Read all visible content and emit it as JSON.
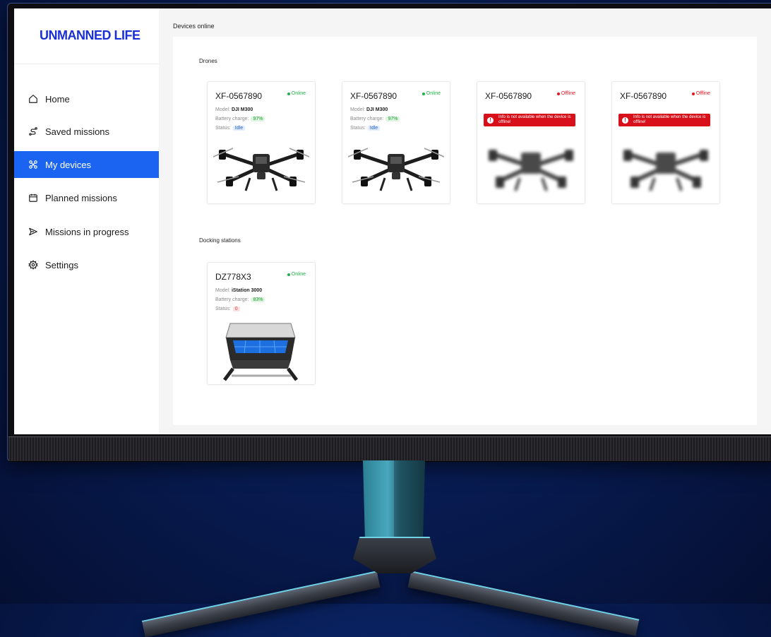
{
  "app": {
    "logo": "UNMANNED LIFE",
    "page_title": "Devices online"
  },
  "sidebar": {
    "items": [
      {
        "label": "Home",
        "icon": "home-icon",
        "active": false
      },
      {
        "label": "Saved missions",
        "icon": "route-icon",
        "active": false
      },
      {
        "label": "My devices",
        "icon": "drone-icon",
        "active": true
      },
      {
        "label": "Planned missions",
        "icon": "calendar-icon",
        "active": false
      },
      {
        "label": "Missions in progress",
        "icon": "send-icon",
        "active": false
      },
      {
        "label": "Settings",
        "icon": "gear-icon",
        "active": false
      }
    ]
  },
  "sections": {
    "drones_title": "Drones",
    "docking_title": "Docking stations"
  },
  "labels": {
    "model": "Model:",
    "battery": "Battery charge:",
    "status": "Status:"
  },
  "drones": [
    {
      "id": "XF-0567890",
      "state": "Online",
      "model": "DJI M300",
      "battery": "97%",
      "status": "Idle"
    },
    {
      "id": "XF-0567890",
      "state": "Online",
      "model": "DJI M300",
      "battery": "97%",
      "status": "Idle"
    },
    {
      "id": "XF-0567890",
      "state": "Offline",
      "alert": "Info is not available when the device is offline!"
    },
    {
      "id": "XF-0567890",
      "state": "Offline",
      "alert": "Info is not available when the device is offline!"
    }
  ],
  "docking": [
    {
      "id": "DZ778X3",
      "state": "Online",
      "model": "iStation 3000",
      "battery": "83%",
      "status": "0"
    }
  ],
  "colors": {
    "accent": "#1b64f2",
    "logo": "#1a2fd6",
    "online": "#21b24a",
    "offline": "#e3141e"
  }
}
